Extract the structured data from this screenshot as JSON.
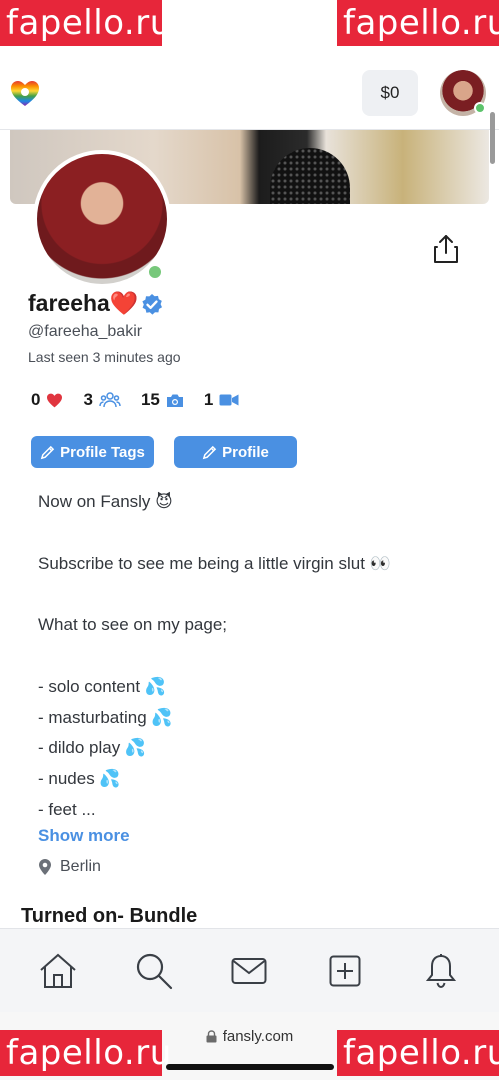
{
  "watermark": "fapello.ru",
  "header": {
    "wallet_label": "$0",
    "logo_icon": "fansly-heart-logo"
  },
  "profile": {
    "display_name": "fareeha❤️",
    "handle": "@fareeha_bakir",
    "last_seen": "Last seen 3 minutes ago",
    "verified": true,
    "online": true
  },
  "stats": [
    {
      "value": "0",
      "icon": "heart-icon",
      "color": "#e0353f"
    },
    {
      "value": "3",
      "icon": "subscribers-icon",
      "color": "#4a90e2"
    },
    {
      "value": "15",
      "icon": "camera-icon",
      "color": "#4a90e2"
    },
    {
      "value": "1",
      "icon": "video-icon",
      "color": "#4a90e2"
    }
  ],
  "buttons": {
    "profile_tags": "Profile Tags",
    "profile": "Profile"
  },
  "bio": [
    "Now on Fansly 😈",
    "",
    "Subscribe to see me being a little virgin slut 👀",
    "",
    "What to see on my page;",
    "",
    "- solo content 💦",
    "- masturbating 💦",
    "- dildo play 💦",
    "- nudes 💦",
    "- feet ..."
  ],
  "show_more": "Show more",
  "location": "Berlin",
  "section_title": "Turned on- Bundle",
  "nav": [
    "home-icon",
    "search-icon",
    "messages-icon",
    "create-post-icon",
    "notifications-icon"
  ],
  "browser": {
    "url": "fansly.com"
  },
  "colors": {
    "accent": "#4a90e2",
    "online": "#5cc36b",
    "watermark": "#e7263a"
  }
}
